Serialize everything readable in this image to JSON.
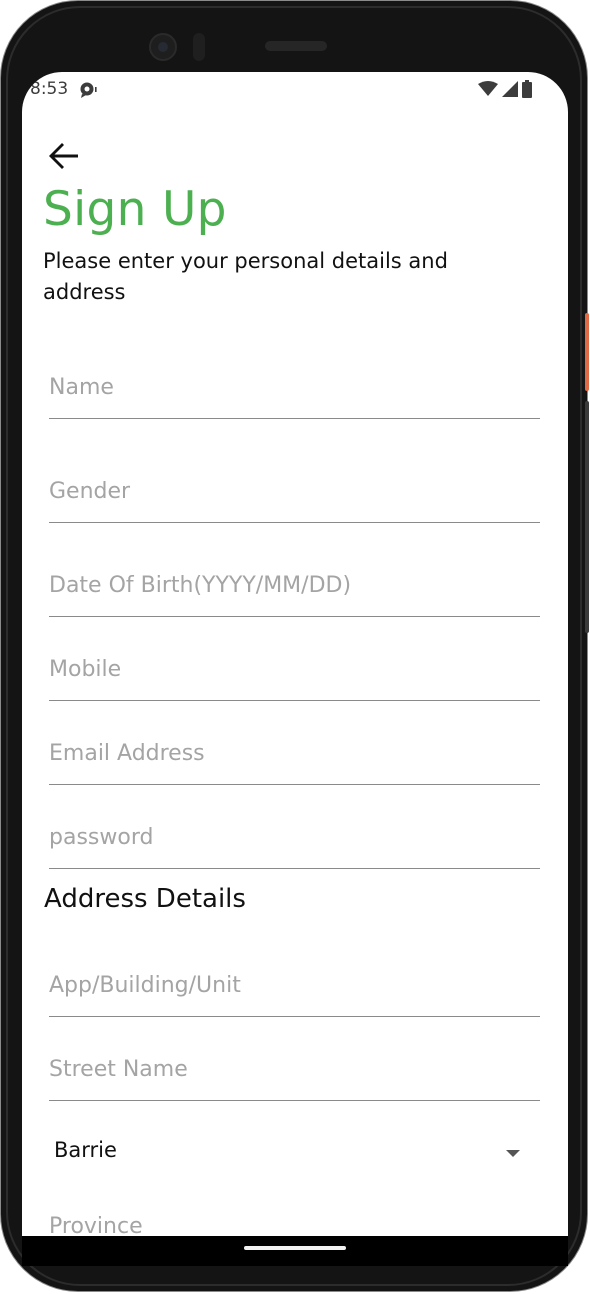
{
  "status_bar": {
    "time": "8:53",
    "icons": [
      "chat-notification-icon",
      "wifi-icon",
      "cellular-signal-icon",
      "battery-icon"
    ]
  },
  "header": {
    "back_icon": "arrow-left-icon",
    "title": "Sign Up",
    "subtitle": "Please enter your personal details and address"
  },
  "personal_fields": [
    {
      "placeholder": "Name",
      "value": ""
    },
    {
      "placeholder": "Gender",
      "value": ""
    },
    {
      "placeholder": "Date Of Birth(YYYY/MM/DD)",
      "value": ""
    },
    {
      "placeholder": "Mobile",
      "value": ""
    },
    {
      "placeholder": "Email Address",
      "value": ""
    },
    {
      "placeholder": "password",
      "value": ""
    }
  ],
  "address": {
    "heading": "Address Details",
    "unit_placeholder": "App/Building/Unit",
    "street_placeholder": "Street Name",
    "city_selected": "Barrie",
    "province_placeholder": "Province"
  },
  "colors": {
    "accent": "#4caf50",
    "placeholder": "#a4a4a4",
    "underline": "#8a8a8a"
  }
}
